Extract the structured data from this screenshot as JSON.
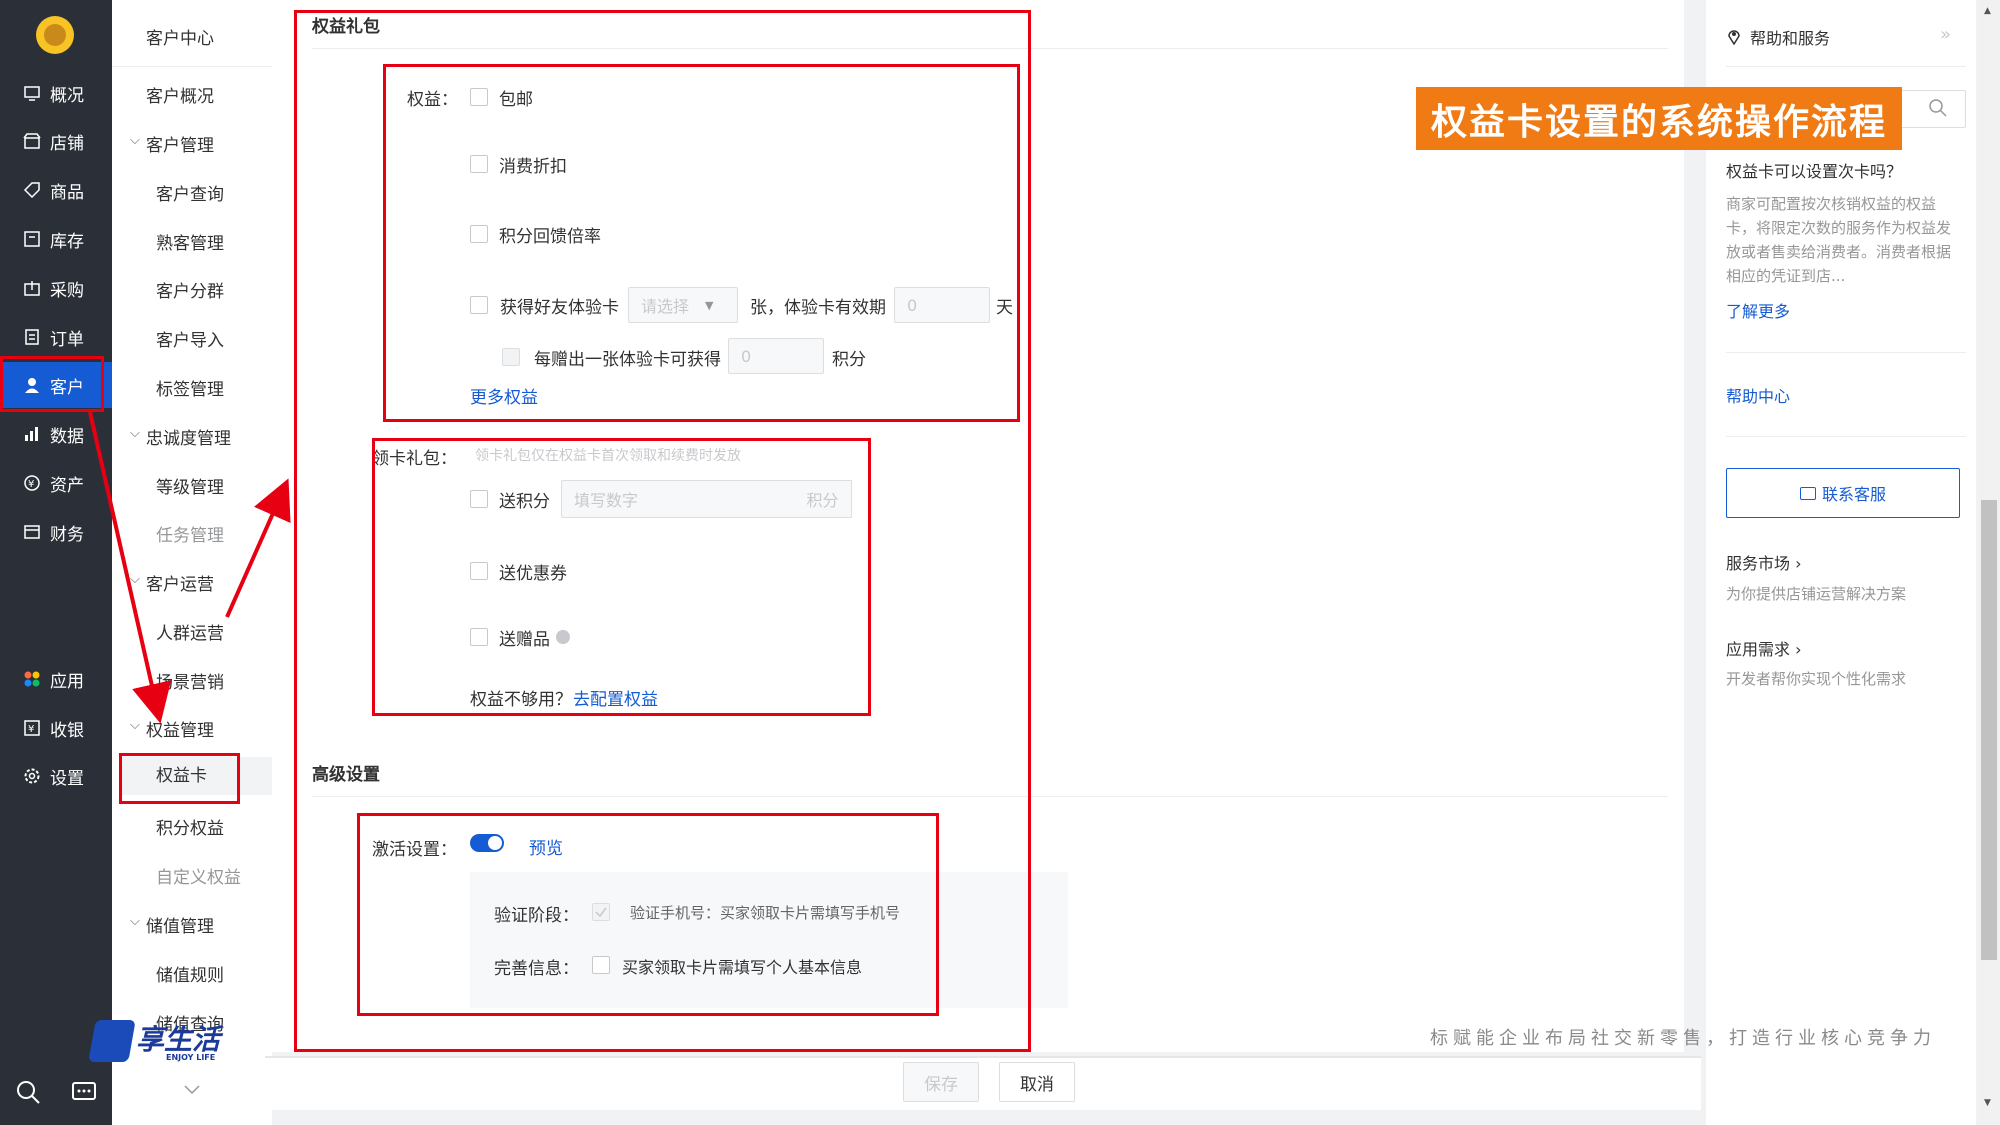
{
  "nav": {
    "items": [
      {
        "label": "概况",
        "icon": "overview-icon"
      },
      {
        "label": "店铺",
        "icon": "store-icon"
      },
      {
        "label": "商品",
        "icon": "tag-icon"
      },
      {
        "label": "库存",
        "icon": "inventory-icon"
      },
      {
        "label": "采购",
        "icon": "purchase-icon"
      },
      {
        "label": "订单",
        "icon": "order-icon"
      },
      {
        "label": "客户",
        "icon": "user-icon"
      },
      {
        "label": "数据",
        "icon": "chart-icon"
      },
      {
        "label": "资产",
        "icon": "asset-icon"
      },
      {
        "label": "财务",
        "icon": "finance-icon"
      },
      {
        "label": "应用",
        "icon": "apps-icon"
      },
      {
        "label": "收银",
        "icon": "cashier-icon"
      },
      {
        "label": "设置",
        "icon": "gear-icon"
      }
    ],
    "active": "客户"
  },
  "subnav": {
    "header": "客户中心",
    "overview": "客户概况",
    "g1": "客户管理",
    "g1_items": [
      "客户查询",
      "熟客管理",
      "客户分群",
      "客户导入",
      "标签管理"
    ],
    "g2": "忠诚度管理",
    "g2_items": [
      "等级管理",
      "任务管理"
    ],
    "g3": "客户运营",
    "g3_items": [
      "人群运营",
      "场景营销"
    ],
    "g4": "权益管理",
    "g4_items": [
      "权益卡",
      "积分权益",
      "自定义权益"
    ],
    "g5": "储值管理",
    "g5_items": [
      "储值规则",
      "储值查询"
    ]
  },
  "form": {
    "section1": "权益礼包",
    "benefits_label": "权益：",
    "b1": "包邮",
    "b2": "消费折扣",
    "b3": "积分回馈倍率",
    "b4": "获得好友体验卡",
    "select_placeholder": "请选择",
    "b4_mid": "张，体验卡有效期",
    "b4_days_value": "0",
    "b4_days_unit": "天",
    "b5": "每赠出一张体验卡可获得",
    "b5_value": "0",
    "b5_unit": "积分",
    "more": "更多权益",
    "gift_label": "领卡礼包：",
    "gift_hint": "领卡礼包仅在权益卡首次领取和续费时发放",
    "g1": "送积分",
    "g1_placeholder": "填写数字",
    "g1_unit": "积分",
    "g2": "送优惠券",
    "g3": "送赠品",
    "not_enough": "权益不够用？",
    "configure": "去配置权益",
    "section2": "高级设置",
    "activate_label": "激活设置：",
    "preview": "预览",
    "verify_label": "验证阶段：",
    "verify_text": "验证手机号：买家领取卡片需填写手机号",
    "info_label": "完善信息：",
    "info_text": "买家领取卡片需填写个人基本信息",
    "save": "保存",
    "cancel": "取消"
  },
  "help": {
    "title": "帮助和服务",
    "q": "权益卡可以设置次卡吗？",
    "a": "商家可配置按次核销权益的权益卡，将限定次数的服务作为权益发放或者售卖给消费者。消费者根据相应的凭证到店...",
    "more": "了解更多",
    "center": "帮助中心",
    "contact": "联系客服",
    "market": "服务市场 ›",
    "market_desc": "为你提供店铺运营解决方案",
    "need": "应用需求 ›",
    "need_desc": "开发者帮你实现个性化需求"
  },
  "overlay": {
    "banner": "权益卡设置的系统操作流程",
    "logo": "享生活",
    "logo_sub": "ENJOY LIFE",
    "slogan": "标赋能企业布局社交新零售，打造行业核心竞争力"
  }
}
